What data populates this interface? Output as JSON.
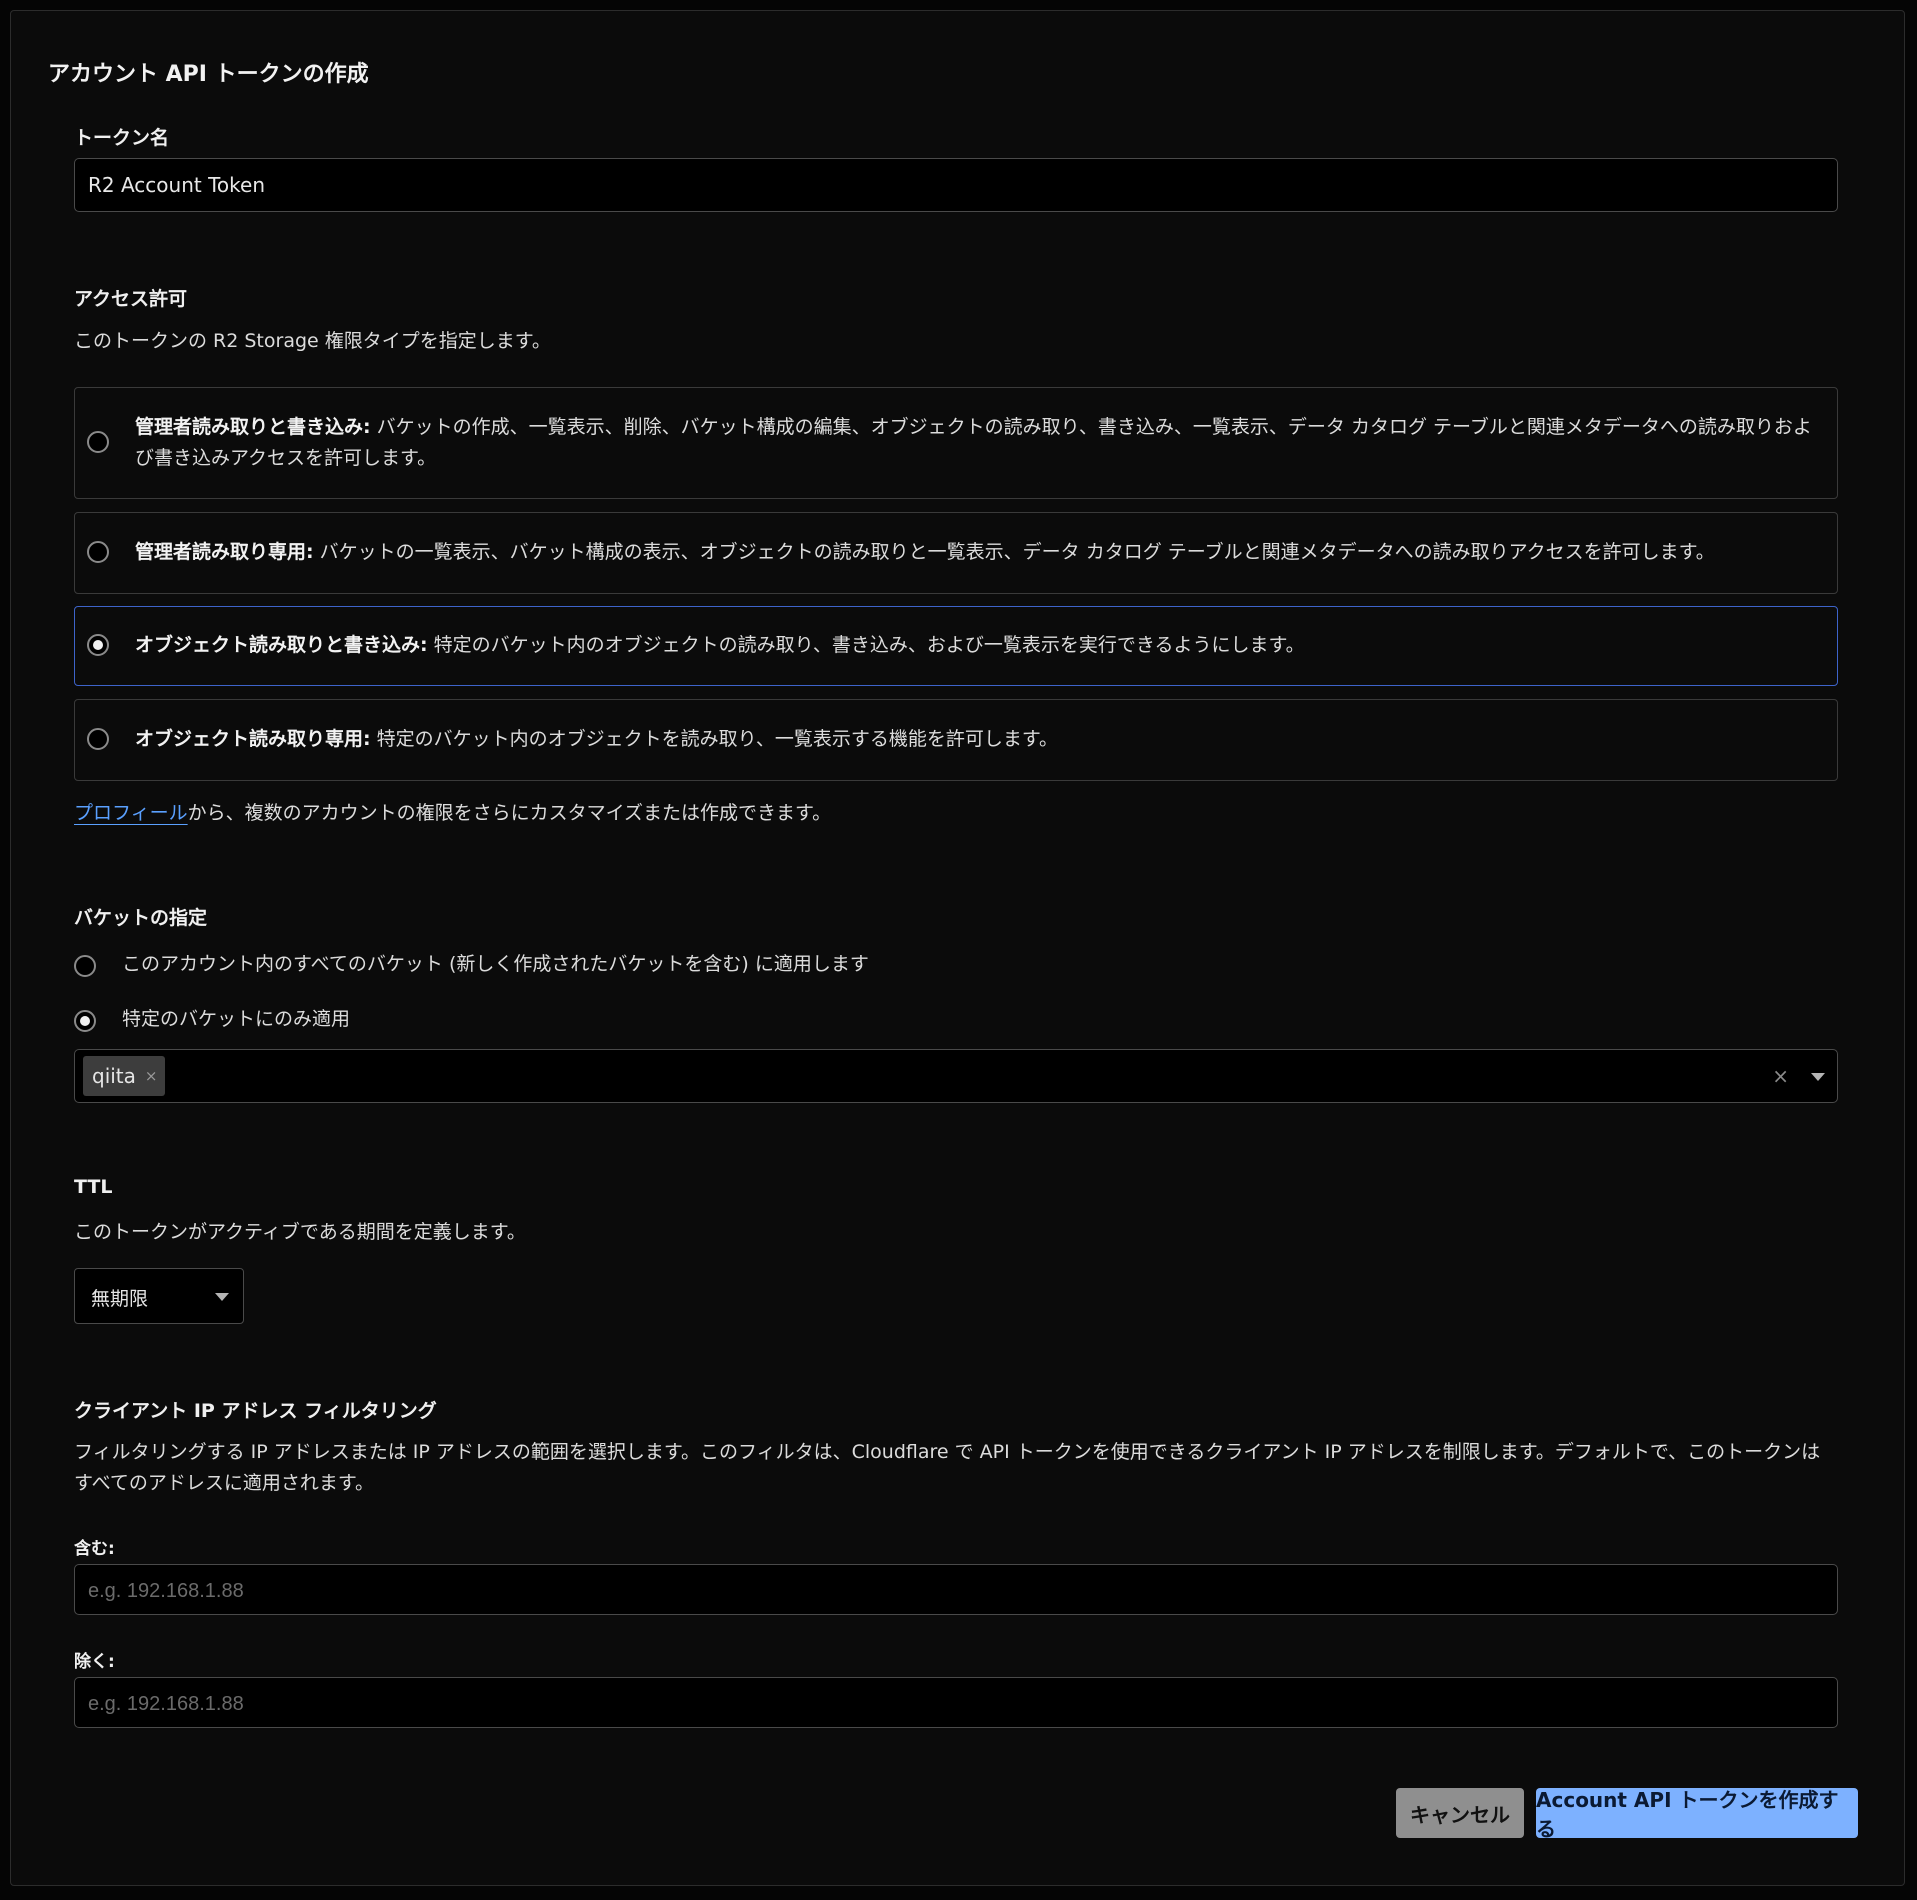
{
  "dialog": {
    "title": "アカウント API トークンの作成"
  },
  "token_name": {
    "label": "トークン名",
    "value": "R2 Account Token"
  },
  "permissions": {
    "label": "アクセス許可",
    "description": "このトークンの R2 Storage 権限タイプを指定します。",
    "options": [
      {
        "title": "管理者読み取りと書き込み:",
        "description": "バケットの作成、一覧表示、削除、バケット構成の編集、オブジェクトの読み取り、書き込み、一覧表示、データ カタログ テーブルと関連メタデータへの読み取りおよび書き込みアクセスを許可します。",
        "selected": false
      },
      {
        "title": "管理者読み取り専用:",
        "description": "バケットの一覧表示、バケット構成の表示、オブジェクトの読み取りと一覧表示、データ カタログ テーブルと関連メタデータへの読み取りアクセスを許可します。",
        "selected": false
      },
      {
        "title": "オブジェクト読み取りと書き込み:",
        "description": "特定のバケット内のオブジェクトの読み取り、書き込み、および一覧表示を実行できるようにします。",
        "selected": true
      },
      {
        "title": "オブジェクト読み取り専用:",
        "description": "特定のバケット内のオブジェクトを読み取り、一覧表示する機能を許可します。",
        "selected": false
      }
    ],
    "profile_link": "プロフィール",
    "profile_note": "から、複数のアカウントの権限をさらにカスタマイズまたは作成できます。"
  },
  "buckets": {
    "label": "バケットの指定",
    "options": [
      {
        "label": "このアカウント内のすべてのバケット (新しく作成されたバケットを含む) に適用します",
        "selected": false
      },
      {
        "label": "特定のバケットにのみ適用",
        "selected": true
      }
    ],
    "selected_tags": [
      "qiita"
    ],
    "tag_remove_glyph": "×",
    "clear_glyph": "×"
  },
  "ttl": {
    "label": "TTL",
    "description": "このトークンがアクティブである期間を定義します。",
    "value": "無期限"
  },
  "ip_filter": {
    "label": "クライアント IP アドレス フィルタリング",
    "description": "フィルタリングする IP アドレスまたは IP アドレスの範囲を選択します。このフィルタは、Cloudflare で API トークンを使用できるクライアント IP アドレスを制限します。デフォルトで、このトークンはすべてのアドレスに適用されます。",
    "include_label": "含む:",
    "include_placeholder": "e.g. 192.168.1.88",
    "exclude_label": "除く:",
    "exclude_placeholder": "e.g. 192.168.1.88"
  },
  "actions": {
    "cancel": "キャンセル",
    "create": "Account API トークンを作成する"
  },
  "colors": {
    "accent": "#7db1ff",
    "selected_border": "#3d63c9",
    "link": "#5aa0ff"
  }
}
